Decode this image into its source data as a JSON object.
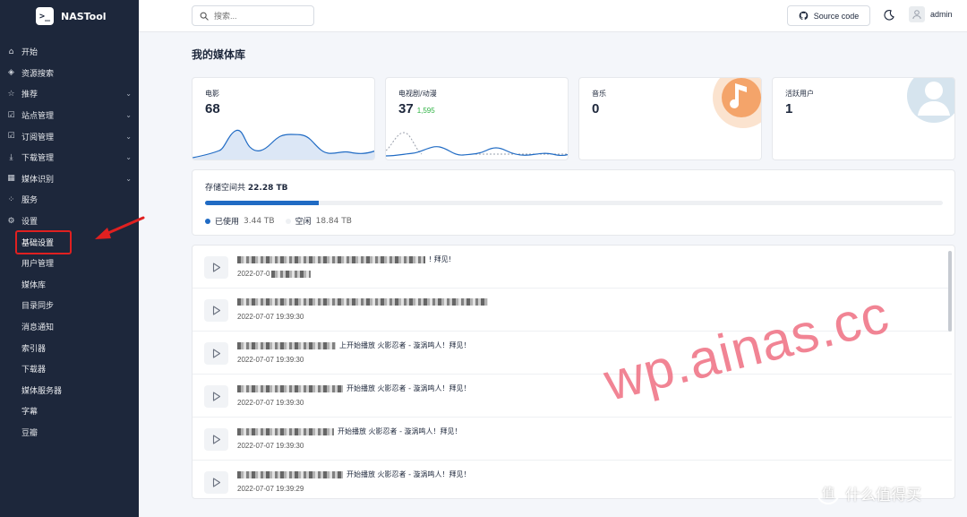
{
  "app": {
    "name": "NASTool",
    "logo_glyph": ">_"
  },
  "sidebar": {
    "items": [
      {
        "label": "开始",
        "icon": "home-icon",
        "glyph": "⌂",
        "chevron": false
      },
      {
        "label": "资源搜索",
        "icon": "cube-icon",
        "glyph": "◈",
        "chevron": false
      },
      {
        "label": "推荐",
        "icon": "star-icon",
        "glyph": "☆",
        "chevron": true
      },
      {
        "label": "站点管理",
        "icon": "checkbox-icon",
        "glyph": "☑",
        "chevron": true
      },
      {
        "label": "订阅管理",
        "icon": "checkbox-icon",
        "glyph": "☑",
        "chevron": true
      },
      {
        "label": "下载管理",
        "icon": "download-icon",
        "glyph": "⤓",
        "chevron": true
      },
      {
        "label": "媒体识别",
        "icon": "film-icon",
        "glyph": "▦",
        "chevron": true
      },
      {
        "label": "服务",
        "icon": "apps-icon",
        "glyph": "⁘",
        "chevron": false
      },
      {
        "label": "设置",
        "icon": "gear-icon",
        "glyph": "⚙",
        "chevron": false
      }
    ],
    "settings_sub": [
      "基础设置",
      "用户管理",
      "媒体库",
      "目录同步",
      "消息通知",
      "索引器",
      "下载器",
      "媒体服务器",
      "字幕",
      "豆瓣"
    ],
    "chevron_glyph": "⌄"
  },
  "header": {
    "search_placeholder": "搜索...",
    "source_label": "Source code",
    "user_name": "admin"
  },
  "main": {
    "title": "我的媒体库",
    "stats": [
      {
        "label": "电影",
        "value": "68",
        "sub": ""
      },
      {
        "label": "电视剧/动漫",
        "value": "37",
        "sub": "1,595"
      },
      {
        "label": "音乐",
        "value": "0",
        "sub": ""
      },
      {
        "label": "活跃用户",
        "value": "1",
        "sub": ""
      }
    ],
    "storage": {
      "label": "存储空间共",
      "total": "22.28 TB",
      "used_fraction": 0.154,
      "used_label": "已使用",
      "used_value": "3.44 TB",
      "free_label": "空闲",
      "free_value": "18.84 TB"
    },
    "messages": [
      {
        "text": "! 拜见!",
        "time": "2022-07-0"
      },
      {
        "text": "",
        "time": "2022-07-07 19:39:30"
      },
      {
        "text": "上开始播放 火影忍者 - 漩涡鸣人！拜见！",
        "time": "2022-07-07 19:39:30"
      },
      {
        "text": "开始播放 火影忍者 - 漩涡鸣人！拜见！",
        "time": "2022-07-07 19:39:30"
      },
      {
        "text": "开始播放 火影忍者 - 漩涡鸣人！拜见！",
        "time": "2022-07-07 19:39:30"
      },
      {
        "text": "开始播放 火影忍者 - 漩涡鸣人！拜见！",
        "time": "2022-07-07 19:39:29"
      }
    ]
  },
  "watermark": "wp.ainas.cc",
  "corner_watermark": {
    "glyph": "值",
    "text": "什么值得买"
  },
  "colors": {
    "sidebar": "#1d273b",
    "accent": "#206bc4",
    "annotation": "#e02020",
    "watermark": "#f07a8c"
  }
}
